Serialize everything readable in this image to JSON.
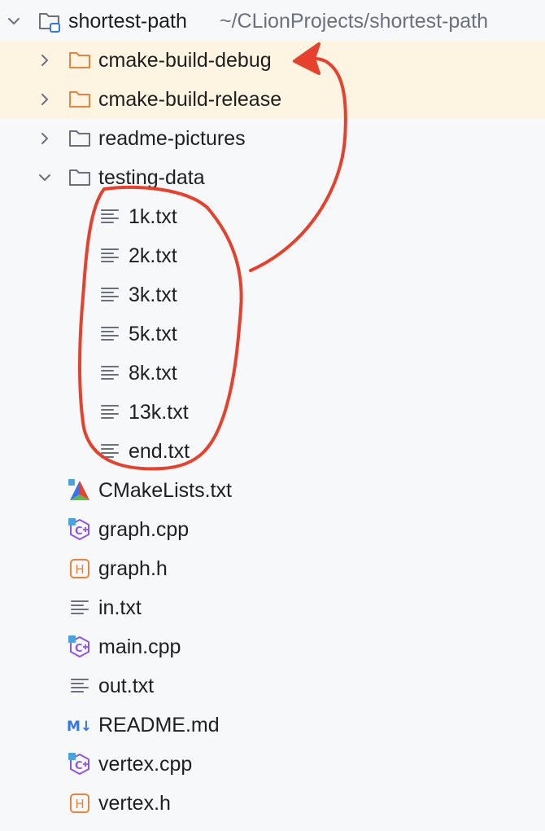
{
  "project": {
    "name": "shortest-path",
    "path": "~/CLionProjects/shortest-path"
  },
  "folders": {
    "cmake_debug": "cmake-build-debug",
    "cmake_release": "cmake-build-release",
    "readme_pictures": "readme-pictures",
    "testing_data": "testing-data"
  },
  "testing_files": [
    "1k.txt",
    "2k.txt",
    "3k.txt",
    "5k.txt",
    "8k.txt",
    "13k.txt",
    "end.txt"
  ],
  "root_files": {
    "cmakelists": "CMakeLists.txt",
    "graph_cpp": "graph.cpp",
    "graph_h": "graph.h",
    "in_txt": "in.txt",
    "main_cpp": "main.cpp",
    "out_txt": "out.txt",
    "readme_md": "README.md",
    "vertex_cpp": "vertex.cpp",
    "vertex_h": "vertex.h"
  },
  "icon_glyphs": {
    "header_h": "H",
    "cpp_c": "C",
    "markdown": "M↓"
  },
  "colors": {
    "excluded_row_bg": "#fdf5e2",
    "excluded_folder": "#e8853a",
    "folder": "#6c707e",
    "cpp_purple": "#8f56e6",
    "header_orange": "#e8853a",
    "markdown_blue": "#3574f0",
    "annotation_red": "#e5412d"
  }
}
